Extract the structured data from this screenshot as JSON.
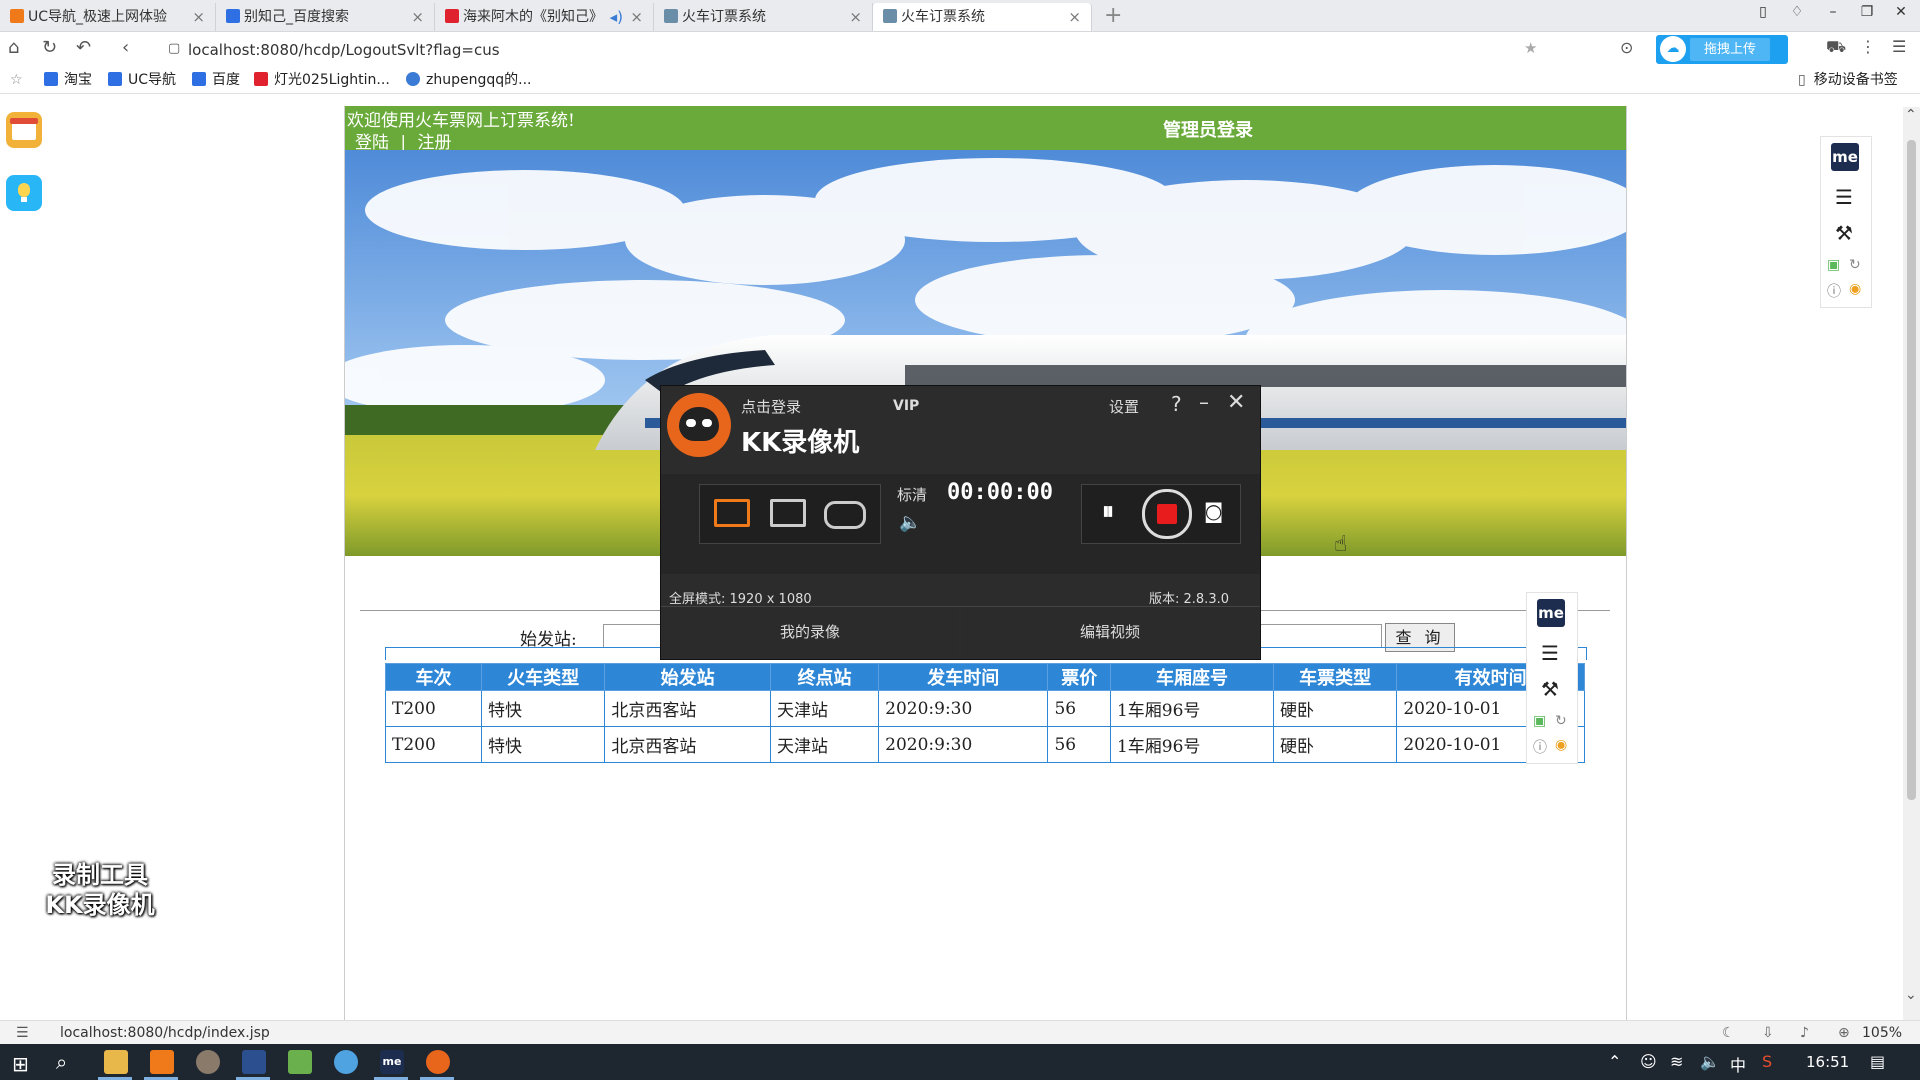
{
  "browser": {
    "tabs": [
      {
        "title": "UC导航_极速上网体验",
        "color": "#f07a1a"
      },
      {
        "title": "别知己_百度搜索",
        "color": "#2f6fe4"
      },
      {
        "title": "海来阿木的《别知己》",
        "color": "#e0222f"
      },
      {
        "title": "火车订票系统",
        "color": "#6b8ea8"
      },
      {
        "title": "火车订票系统",
        "color": "#6b8ea8"
      }
    ],
    "url": "localhost:8080/hcdp/LogoutSvlt?flag=cus",
    "upload_label": "拖拽上传",
    "bookmarks": [
      {
        "label": "淘宝",
        "color": "#2f6fe4"
      },
      {
        "label": "UC导航",
        "color": "#2f6fe4"
      },
      {
        "label": "百度",
        "color": "#2f6fe4"
      },
      {
        "label": "灯光025Lightin...",
        "color": "#e0222f"
      },
      {
        "label": "zhupengqq的...",
        "color": "#3a7bd5"
      }
    ],
    "mobile_bookmarks": "移动设备书签",
    "status_url": "localhost:8080/hcdp/index.jsp",
    "zoom": "105%"
  },
  "site": {
    "welcome": "欢迎使用火车票网上订票系统!",
    "login": "登陆",
    "separator": "|",
    "register": "注册",
    "admin_login": "管理员登录",
    "start_label": "始发站:",
    "query_button": "查 询",
    "columns": [
      "车次",
      "火车类型",
      "始发站",
      "终点站",
      "发车时间",
      "票价",
      "车厢座号",
      "车票类型",
      "有效时间"
    ],
    "rows": [
      [
        "T200",
        "特快",
        "北京西客站",
        "天津站",
        "2020:9:30",
        "56",
        "1车厢96号",
        "硬卧",
        "2020-10-01"
      ],
      [
        "T200",
        "特快",
        "北京西客站",
        "天津站",
        "2020:9:30",
        "56",
        "1车厢96号",
        "硬卧",
        "2020-10-01"
      ]
    ],
    "header_color": "#6aaa3a",
    "table_color": "#2d86d6"
  },
  "recorder": {
    "login": "点击登录",
    "vip": "VIP",
    "settings": "设置",
    "help": "?",
    "title": "KK录像机",
    "quality": "标清",
    "timer": "00:00:00",
    "mode": "全屏模式: 1920 x 1080",
    "version": "版本: 2.8.3.0",
    "my_recordings": "我的录像",
    "edit_video": "编辑视频"
  },
  "watermark": [
    "录制工具",
    "KK录像机"
  ],
  "taskbar": {
    "time": "16:51"
  }
}
